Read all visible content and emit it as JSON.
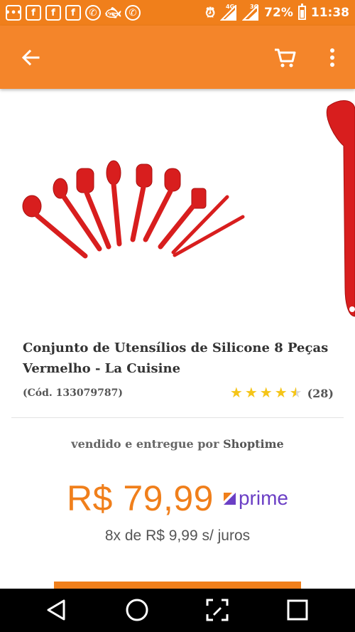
{
  "status_bar": {
    "battery": "72%",
    "time": "11:38",
    "network_1": "4G",
    "network_2": "3G",
    "icons_left": [
      "chat-icon",
      "facebook-icon",
      "facebook-icon",
      "facebook-icon",
      "whatsapp-icon",
      "fish-icon",
      "whatsapp-icon"
    ]
  },
  "app_bar": {
    "back_icon": "arrow-back-icon",
    "cart_icon": "cart-icon",
    "menu_icon": "more-vert-icon"
  },
  "product": {
    "title": "Conjunto de Utensílios de Silicone 8 Peças Vermelho - La Cuisine",
    "code": "(Cód. 133079787)",
    "rating": 4.5,
    "rating_count": "(28)"
  },
  "seller": {
    "prefix": "vendido e entregue por",
    "name": "Shoptime"
  },
  "pricing": {
    "price": "R$ 79,99",
    "prime_label": "prime",
    "installments": "8x de R$ 9,99 s/ juros"
  },
  "colors": {
    "accent": "#f07f1b",
    "prime": "#6b3fc5",
    "product_red": "#d81e1e"
  },
  "nav_bar": {
    "back_icon": "triangle-back-icon",
    "home_icon": "circle-home-icon",
    "edit_icon": "edit-screen-icon",
    "recents_icon": "square-recents-icon"
  }
}
